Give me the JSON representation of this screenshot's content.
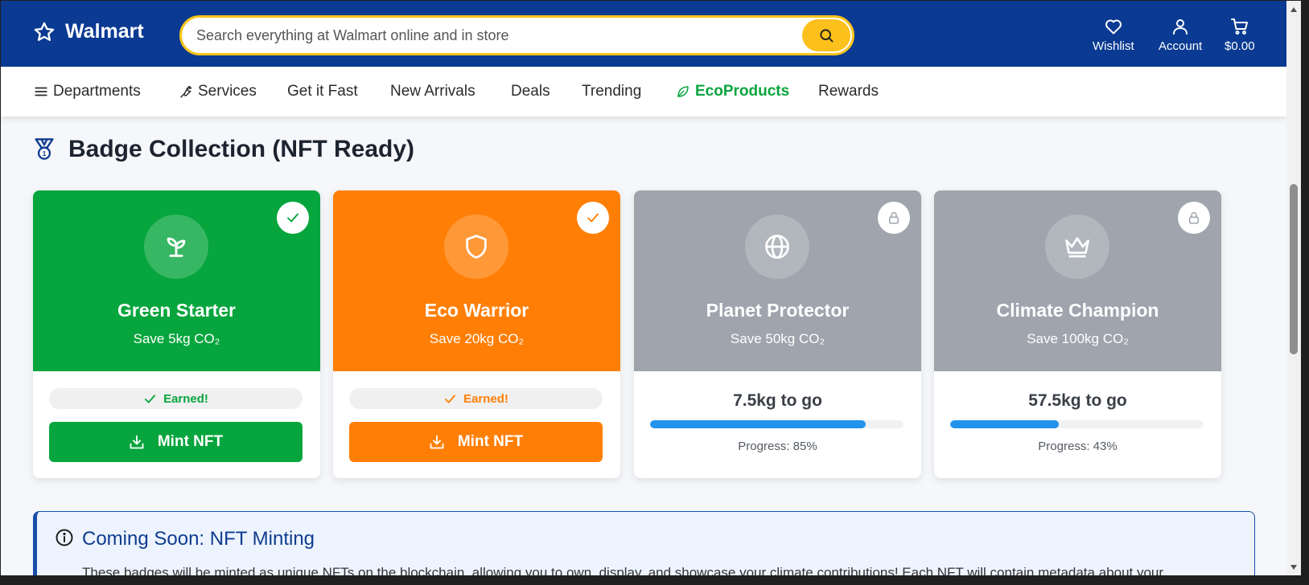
{
  "header": {
    "brand": "Walmart",
    "search_placeholder": "Search everything at Walmart online and in store",
    "actions": [
      {
        "label": "Wishlist",
        "icon": "heart-icon"
      },
      {
        "label": "Account",
        "icon": "user-icon"
      },
      {
        "label": "$0.00",
        "icon": "cart-icon"
      }
    ]
  },
  "nav": {
    "items": [
      {
        "label": "Departments",
        "icon": "menu-icon"
      },
      {
        "label": "Services",
        "icon": "wrench-icon"
      },
      {
        "label": "Get it Fast"
      },
      {
        "label": "New Arrivals"
      },
      {
        "label": "Deals"
      },
      {
        "label": "Trending"
      },
      {
        "label": "EcoProducts",
        "icon": "leaf-icon"
      },
      {
        "label": "Rewards"
      }
    ]
  },
  "section": {
    "title": "Badge Collection (NFT Ready)",
    "icon": "medal-icon"
  },
  "badges": [
    {
      "name": "Green Starter",
      "goal": "Save 5kg CO₂",
      "status": "Earned!",
      "action": "Mint NFT",
      "color": "#06a53d",
      "icon": "sprout-icon"
    },
    {
      "name": "Eco Warrior",
      "goal": "Save 20kg CO₂",
      "status": "Earned!",
      "action": "Mint NFT",
      "color": "#ff7f06",
      "icon": "shield-icon"
    },
    {
      "name": "Planet Protector",
      "goal": "Save 50kg CO₂",
      "remaining": "7.5kg to go",
      "progress_label": "Progress: 85%",
      "progress": 85,
      "color": "#9fa4ad",
      "icon": "globe-icon"
    },
    {
      "name": "Climate Champion",
      "goal": "Save 100kg CO₂",
      "remaining": "57.5kg to go",
      "progress_label": "Progress: 43%",
      "progress": 43,
      "color": "#9fa4ad",
      "icon": "crown-icon"
    }
  ],
  "info": {
    "title": "Coming Soon: NFT Minting",
    "text": "These badges will be minted as unique NFTs on the blockchain, allowing you to own, display, and showcase your climate contributions! Each NFT will contain metadata about your"
  },
  "colors": {
    "header_bg": "#0a3a92",
    "accent_yellow": "#fcc01c",
    "eco_green": "#0aa43e",
    "progress_blue": "#2392ec"
  }
}
